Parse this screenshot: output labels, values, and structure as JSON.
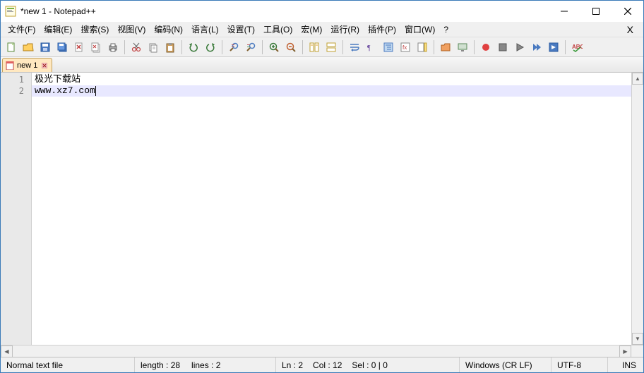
{
  "window": {
    "title": "*new 1 - Notepad++"
  },
  "menus": [
    "文件(F)",
    "编辑(E)",
    "搜索(S)",
    "视图(V)",
    "编码(N)",
    "语言(L)",
    "设置(T)",
    "工具(O)",
    "宏(M)",
    "运行(R)",
    "插件(P)",
    "窗口(W)",
    "?"
  ],
  "toolbar_icons": [
    "new",
    "open",
    "save",
    "save-all",
    "close",
    "close-all",
    "print",
    "sep",
    "cut",
    "copy",
    "paste",
    "sep",
    "undo",
    "redo",
    "sep",
    "find",
    "replace",
    "sep",
    "zoom-in",
    "zoom-out",
    "sep",
    "sync-v",
    "sync-h",
    "sep",
    "wrap",
    "all-chars",
    "indent",
    "lang",
    "doc-map",
    "sep",
    "folder",
    "monitor",
    "sep",
    "record",
    "stop",
    "play",
    "play-multi",
    "save-macro",
    "sep",
    "spell"
  ],
  "tab": {
    "label": "new 1"
  },
  "editor": {
    "lines": [
      "极光下载站",
      "www.xz7.com"
    ],
    "current_line_index": 1
  },
  "status": {
    "file_type": "Normal text file",
    "length_label": "length : 28",
    "lines_label": "lines : 2",
    "ln_label": "Ln : 2",
    "col_label": "Col : 12",
    "sel_label": "Sel : 0 | 0",
    "eol": "Windows (CR LF)",
    "encoding": "UTF-8",
    "mode": "INS"
  }
}
